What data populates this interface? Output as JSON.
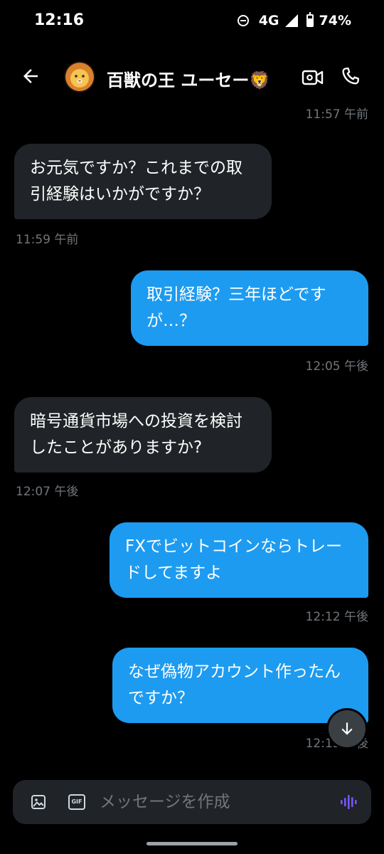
{
  "status_bar": {
    "time": "12:16",
    "network": "4G",
    "battery": "74%",
    "battery_level": 0.74
  },
  "header": {
    "title": "百獣の王 ユーセー🦁",
    "avatar_emoji": "🦁"
  },
  "messages": [
    {
      "direction": "outgoing",
      "timestamp": "11:57 午前"
    },
    {
      "direction": "incoming",
      "text": "お元気ですか？これまでの取引経験はいかがですか？",
      "timestamp": "11:59 午前"
    },
    {
      "direction": "outgoing",
      "text": "取引経験？三年ほどですが…？",
      "timestamp": "12:05 午後"
    },
    {
      "direction": "incoming",
      "text": "暗号通貨市場への投資を検討したことがありますか?",
      "timestamp": "12:07 午後"
    },
    {
      "direction": "outgoing",
      "text": "FXでビットコインならトレードしてますよ",
      "timestamp": "12:12 午後"
    },
    {
      "direction": "outgoing",
      "text": "なぜ偽物アカウント作ったんですか？",
      "timestamp": "12:13 午後"
    }
  ],
  "composer": {
    "placeholder": "メッセージを作成",
    "gif_label": "GIF"
  },
  "colors": {
    "background": "#000000",
    "incoming_bubble": "#202327",
    "outgoing_bubble": "#1d9bf0",
    "timestamp": "#71767b",
    "voice_accent": "#7856ff"
  },
  "icons": [
    "back-arrow-icon",
    "video-call-icon",
    "phone-icon",
    "image-icon",
    "gif-icon",
    "voice-icon",
    "arrow-down-icon"
  ]
}
